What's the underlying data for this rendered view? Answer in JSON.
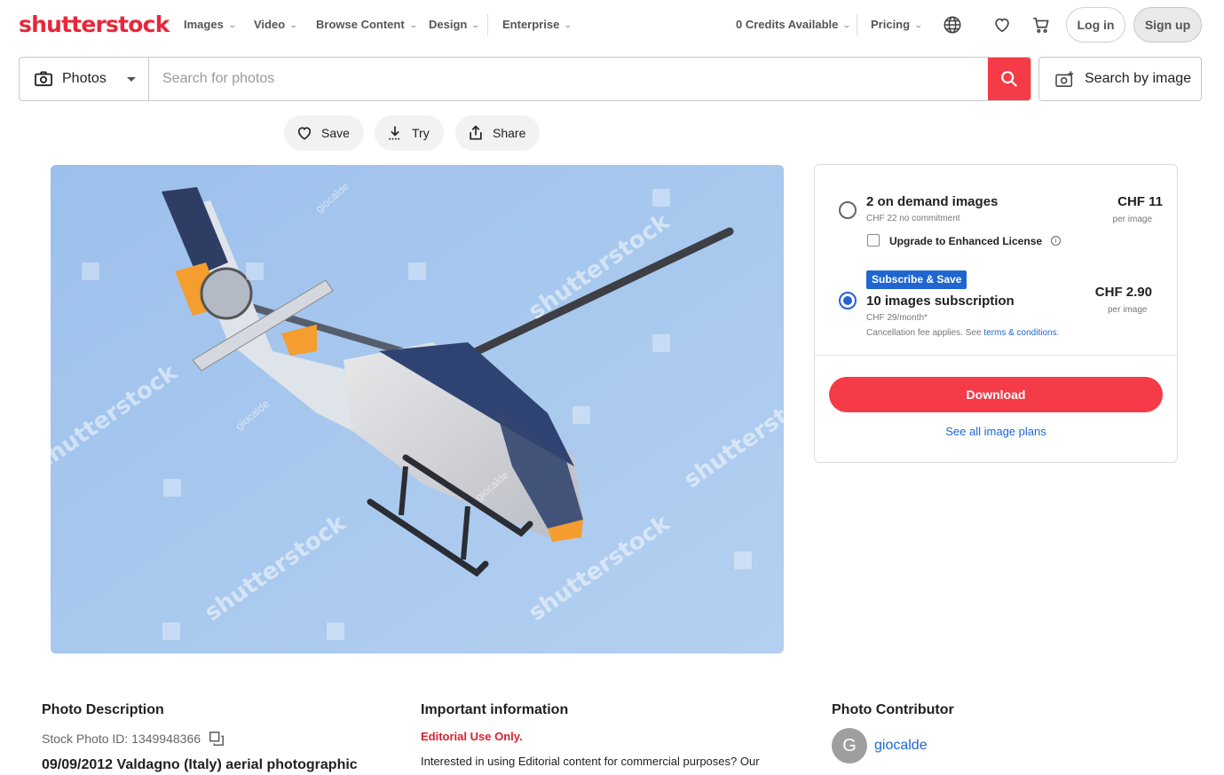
{
  "header": {
    "logo": "shutterstock",
    "nav": [
      "Images",
      "Video",
      "Browse Content",
      "Design",
      "Enterprise"
    ],
    "credits": "0 Credits Available",
    "pricing": "Pricing",
    "login": "Log in",
    "signup": "Sign up"
  },
  "search": {
    "type_label": "Photos",
    "placeholder": "Search for photos",
    "by_image_label": "Search by image"
  },
  "actions": {
    "save": "Save",
    "try": "Try",
    "share": "Share"
  },
  "photo": {
    "watermark": "shutterstock",
    "contributor_mark": "giocalde"
  },
  "pricing_panel": {
    "option1": {
      "title": "2 on demand images",
      "subtitle": "CHF 22 no commitment",
      "price": "CHF 11",
      "per": "per image",
      "enhanced_label": "Upgrade to Enhanced License",
      "selected": false
    },
    "option2": {
      "badge": "Subscribe & Save",
      "title": "10 images subscription",
      "subtitle": "CHF 29/month*",
      "note_prefix": "Cancellation fee applies. See ",
      "note_link": "terms & conditions",
      "note_suffix": ".",
      "price": "CHF 2.90",
      "per": "per image",
      "selected": true
    },
    "download": "Download",
    "plans_link": "See all image plans"
  },
  "description": {
    "heading": "Photo Description",
    "stock_id": "Stock Photo ID: 1349948366",
    "title": "09/09/2012 Valdagno (Italy) aerial photographic"
  },
  "important": {
    "heading": "Important information",
    "editorial": "Editorial Use Only.",
    "text": "Interested in using Editorial content for commercial purposes? Our"
  },
  "contributor": {
    "heading": "Photo Contributor",
    "initial": "G",
    "name": "giocalde"
  },
  "colors": {
    "brand_red": "#e8273a",
    "button_red": "#f53b47",
    "link_blue": "#1f66d1",
    "sky": "#a9c9ed"
  }
}
